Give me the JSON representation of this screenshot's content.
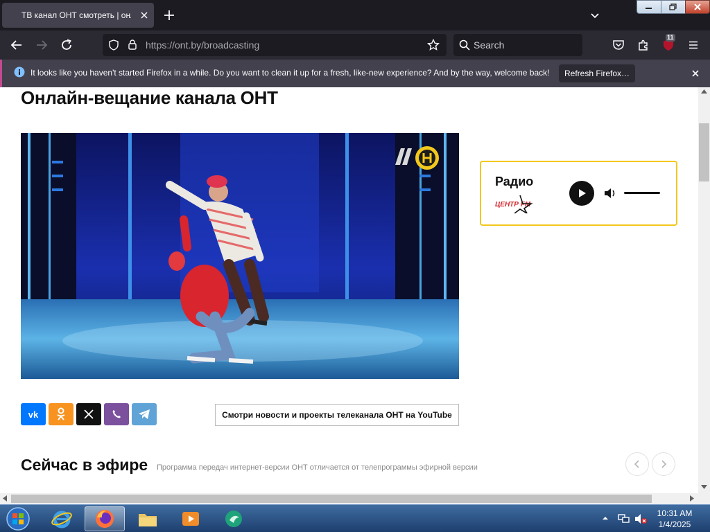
{
  "browser": {
    "tab_title": "ТВ канал ОНТ смотреть | онлайн",
    "url_host": "https://ont.by",
    "url_path": "/broadcasting",
    "search_placeholder": "Search",
    "extensions_badge": "11"
  },
  "notification": {
    "message": "It looks like you haven't started Firefox in a while. Do you want to clean it up for a fresh, like-new experience? And by the way, welcome back!",
    "button_label": "Refresh Firefox…"
  },
  "page": {
    "title": "Онлайн-вещание канала ОНТ",
    "radio": {
      "title": "Радио",
      "logo_text": "ЦЕНТР FM"
    },
    "share": {
      "vk_label": "VK",
      "ok_label": "OK",
      "x_label": "X",
      "viber_label": "Viber",
      "telegram_label": "Telegram"
    },
    "youtube_button": "Смотри новости и проекты телеканала ОНТ на YouTube",
    "onair_title": "Сейчас в эфире",
    "onair_subtitle": "Программа передач интернет-версии ОНТ отличается от телепрограммы эфирной версии"
  },
  "taskbar": {
    "time": "10:31 AM",
    "date": "1/4/2025"
  },
  "colors": {
    "vk": "#0077ff",
    "ok": "#f7931e",
    "x": "#111111",
    "viber": "#7b519d",
    "telegram": "#5fa3d7",
    "radio_border": "#f2c81c"
  }
}
